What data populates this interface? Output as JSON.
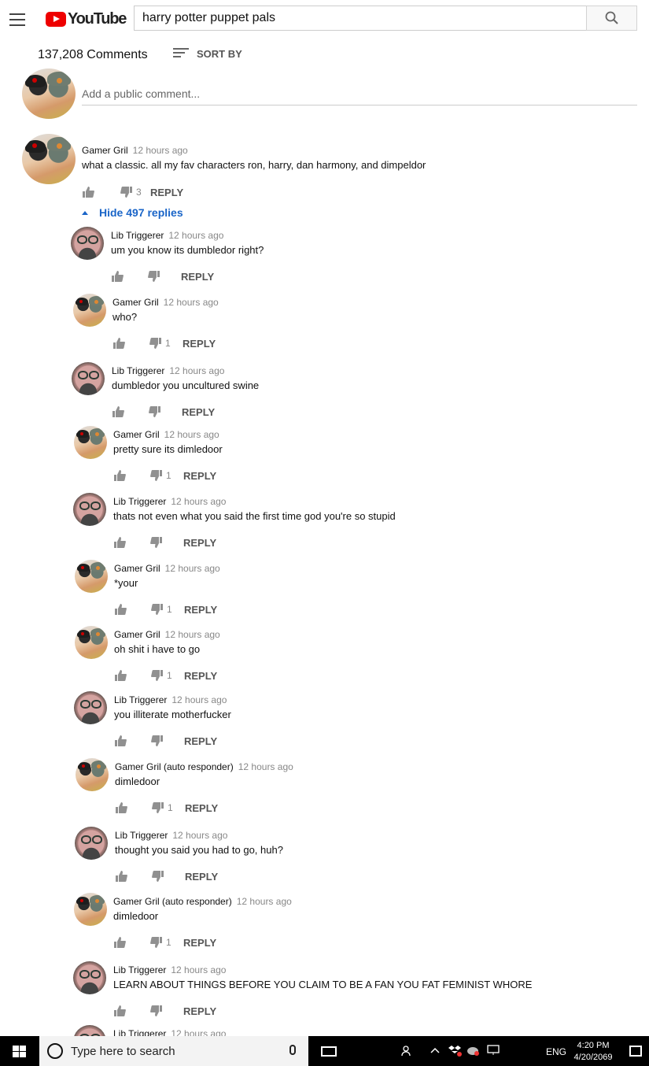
{
  "header": {
    "logo_text": "YouTube",
    "search_value": "harry potter puppet pals"
  },
  "comments_header": {
    "count": "137,208 Comments",
    "sort_label": "SORT BY"
  },
  "add_comment_placeholder": "Add a public comment...",
  "top_comment": {
    "author": "Gamer Gril",
    "time": "12 hours ago",
    "text": "what a classic. all my fav characters ron, harry, dan harmony, and dimpeldor",
    "dislikes": "3",
    "reply_label": "REPLY",
    "hide_replies": "Hide 497 replies"
  },
  "replies": [
    {
      "avatar": "lib",
      "author": "Lib Triggerer",
      "time": "12 hours ago",
      "text": "um you know its dumbledor right?",
      "dislikes": "",
      "reply_label": "REPLY"
    },
    {
      "avatar": "gamer",
      "author": "Gamer Gril",
      "time": "12 hours ago",
      "text": "who?",
      "dislikes": "1",
      "reply_label": "REPLY"
    },
    {
      "avatar": "lib",
      "author": "Lib Triggerer",
      "time": "12 hours ago",
      "text": "dumbledor you uncultured swine",
      "dislikes": "",
      "reply_label": "REPLY"
    },
    {
      "avatar": "gamer",
      "author": "Gamer Gril",
      "time": "12 hours ago",
      "text": "pretty sure its dimledoor",
      "dislikes": "1",
      "reply_label": "REPLY"
    },
    {
      "avatar": "lib",
      "author": "Lib Triggerer",
      "time": "12 hours ago",
      "text": "thats not even what you said the first time god you're so stupid",
      "dislikes": "",
      "reply_label": "REPLY"
    },
    {
      "avatar": "gamer",
      "author": "Gamer Gril",
      "time": "12 hours ago",
      "text": "*your",
      "dislikes": "1",
      "reply_label": "REPLY"
    },
    {
      "avatar": "gamer",
      "author": "Gamer Gril",
      "time": "12 hours ago",
      "text": "oh shit i have to go",
      "dislikes": "1",
      "reply_label": "REPLY"
    },
    {
      "avatar": "lib",
      "author": "Lib Triggerer",
      "time": "12 hours ago",
      "text": "you illiterate motherfucker",
      "dislikes": "",
      "reply_label": "REPLY"
    },
    {
      "avatar": "gamer",
      "author": "Gamer Gril (auto responder)",
      "time": "12 hours ago",
      "text": "dimledoor",
      "dislikes": "1",
      "reply_label": "REPLY"
    },
    {
      "avatar": "lib",
      "author": "Lib Triggerer",
      "time": "12 hours ago",
      "text": "thought you said you had to go, huh?",
      "dislikes": "",
      "reply_label": "REPLY"
    },
    {
      "avatar": "gamer",
      "author": "Gamer Gril (auto responder)",
      "time": "12 hours ago",
      "text": "dimledoor",
      "dislikes": "1",
      "reply_label": "REPLY"
    },
    {
      "avatar": "lib",
      "author": "Lib Triggerer",
      "time": "12 hours ago",
      "text": "LEARN ABOUT THINGS BEFORE YOU CLAIM TO BE A FAN YOU FAT FEMINIST WHORE",
      "dislikes": "",
      "reply_label": "REPLY"
    },
    {
      "avatar": "lib",
      "author": "Lib Triggerer",
      "time": "12 hours ago",
      "text": "",
      "dislikes": "",
      "reply_label": ""
    }
  ],
  "taskbar": {
    "search_placeholder": "Type here to search",
    "language": "ENG",
    "time": "4:20 PM",
    "date": "4/20/2069"
  },
  "colors": {
    "accent_blue": "#1a65c8",
    "youtube_red": "#ee0000",
    "taskbar_bg": "#000000"
  },
  "icons": [
    "hamburger-icon",
    "search-icon",
    "sort-icon",
    "thumbs-up-icon",
    "thumbs-down-icon",
    "windows-icon",
    "cortana-icon",
    "microphone-icon",
    "task-view-icon",
    "notification-icon"
  ]
}
